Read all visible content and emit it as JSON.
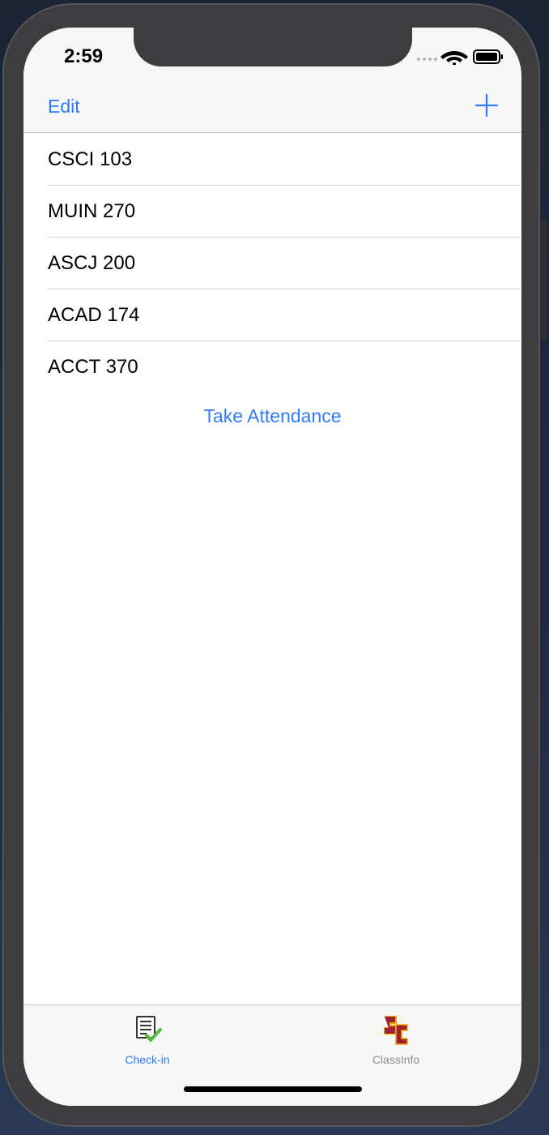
{
  "status_bar": {
    "time": "2:59"
  },
  "nav_bar": {
    "edit_label": "Edit",
    "add_icon": "plus-icon"
  },
  "classes": [
    {
      "label": "CSCI 103"
    },
    {
      "label": "MUIN 270"
    },
    {
      "label": "ASCJ 200"
    },
    {
      "label": "ACAD 174"
    },
    {
      "label": "ACCT 370"
    }
  ],
  "take_attendance_label": "Take Attendance",
  "tab_bar": {
    "tabs": [
      {
        "label": "Check-in",
        "icon": "checklist-icon",
        "selected": true
      },
      {
        "label": "ClassInfo",
        "icon": "sc-logo-icon",
        "selected": false
      }
    ]
  },
  "colors": {
    "accent": "#2f7cf6",
    "bar_background": "#f7f7f7",
    "device_bezel": "#3d3d3f",
    "sc_cardinal": "#9d2235",
    "sc_gold": "#f2a900"
  }
}
